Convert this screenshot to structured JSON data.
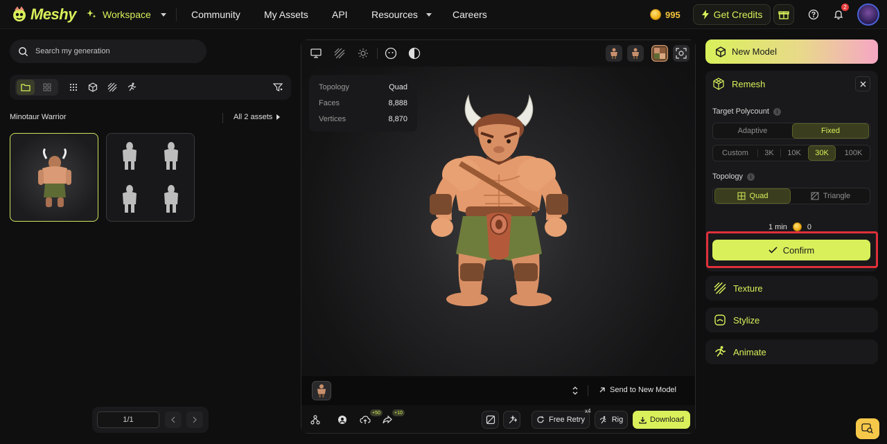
{
  "app": {
    "brand": "Meshy",
    "accent": "#d9f05a"
  },
  "nav": {
    "workspace": "Workspace",
    "items": [
      "Community",
      "My Assets",
      "API",
      "Resources",
      "Careers"
    ],
    "credits": "995",
    "get_credits": "Get Credits",
    "notification_count": "2"
  },
  "left": {
    "search_placeholder": "Search my generation",
    "section_title": "Minotaur Warrior",
    "all_assets": "All 2 assets",
    "pager": "1/1"
  },
  "viewer": {
    "stats": [
      {
        "label": "Topology",
        "value": "Quad"
      },
      {
        "label": "Faces",
        "value": "8,888"
      },
      {
        "label": "Vertices",
        "value": "8,870"
      }
    ],
    "send_to_new_model": "Send to New Model",
    "badge_a": "+50",
    "badge_b": "+10",
    "free_retry": "Free Retry",
    "retry_count": "x4",
    "rig": "Rig",
    "download": "Download"
  },
  "right": {
    "new_model": "New Model",
    "remesh": "Remesh",
    "target_polycount": "Target Polycount",
    "polycount_modes": [
      "Adaptive",
      "Fixed"
    ],
    "polycount_selected_mode": "Fixed",
    "polycount_values": [
      "Custom",
      "3K",
      "10K",
      "30K",
      "100K"
    ],
    "polycount_selected": "30K",
    "topology_label": "Topology",
    "topology_options": [
      "Quad",
      "Triangle"
    ],
    "topology_selected": "Quad",
    "time": "1 min",
    "cost": "0",
    "confirm": "Confirm",
    "texture": "Texture",
    "stylize": "Stylize",
    "animate": "Animate"
  }
}
